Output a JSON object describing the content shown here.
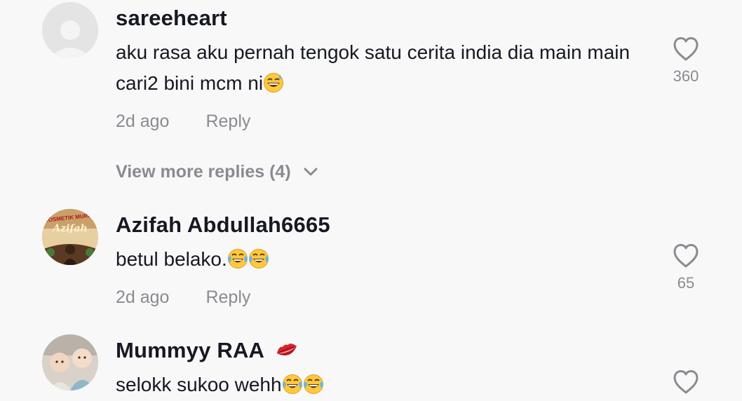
{
  "comments": [
    {
      "username": "sareeheart",
      "text": "aku rasa aku pernah tengok satu cerita india dia main main cari2 bini mcm ni",
      "time": "2d ago",
      "reply_label": "Reply",
      "like_count": "360",
      "view_more_replies": "View more replies (4)"
    },
    {
      "username": "Azifah Abdullah6665",
      "text": "betul belako.",
      "time": "2d ago",
      "reply_label": "Reply",
      "like_count": "65",
      "avatar_text_top": "KOSMETIK MURAH",
      "avatar_text_name": "Azifah"
    },
    {
      "username": "Mummyy RAA",
      "text": "selokk sukoo wehh"
    }
  ],
  "icons": {
    "heart": "heart-outline-icon",
    "chevron": "chevron-down-icon",
    "grin_sweat": "grinning-sweat-emoji",
    "tears_joy": "tears-of-joy-emoji",
    "lips": "kiss-mark-emoji"
  },
  "colors": {
    "background": "#f8f8f8",
    "text_primary": "#161823",
    "text_secondary": "#8a8b91"
  }
}
